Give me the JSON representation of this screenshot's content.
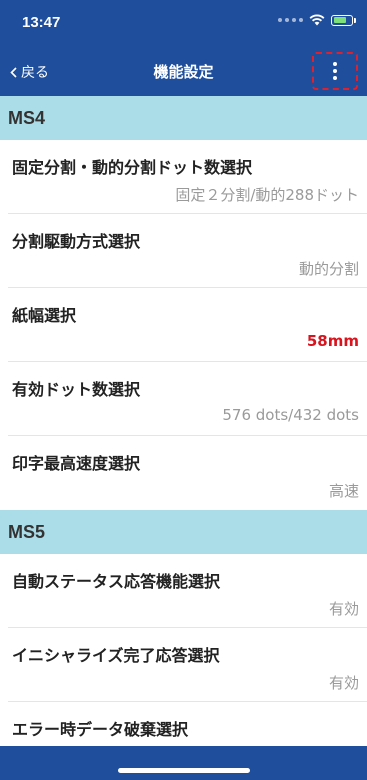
{
  "status_bar": {
    "time": "13:47",
    "icons": [
      "signal-dots-icon",
      "wifi-icon",
      "battery-charging-icon"
    ]
  },
  "nav": {
    "back_label": "戻る",
    "title": "機能設定",
    "more_icon": "kebab-menu-icon",
    "highlight_color": "#e0202c"
  },
  "sections": [
    {
      "title": "MS4",
      "items": [
        {
          "label": "固定分割・動的分割ドット数選択",
          "value": "固定２分割/動的288ドット"
        },
        {
          "label": "分割駆動方式選択",
          "value": "動的分割"
        },
        {
          "label": "紙幅選択",
          "value": "58mm"
        },
        {
          "label": "有効ドット数選択",
          "value": "576 dots/432 dots"
        },
        {
          "label": "印字最高速度選択",
          "value": "高速"
        }
      ]
    },
    {
      "title": "MS5",
      "items": [
        {
          "label": "自動ステータス応答機能選択",
          "value": "有効"
        },
        {
          "label": "イニシャライズ完了応答選択",
          "value": "有効"
        },
        {
          "label": "エラー時データ破棄選択",
          "value": ""
        }
      ]
    }
  ],
  "colors": {
    "primary": "#1f4f9c",
    "section_bg": "#abdde8",
    "value_gray": "#9a9a9a",
    "value_red": "#d8141e"
  }
}
